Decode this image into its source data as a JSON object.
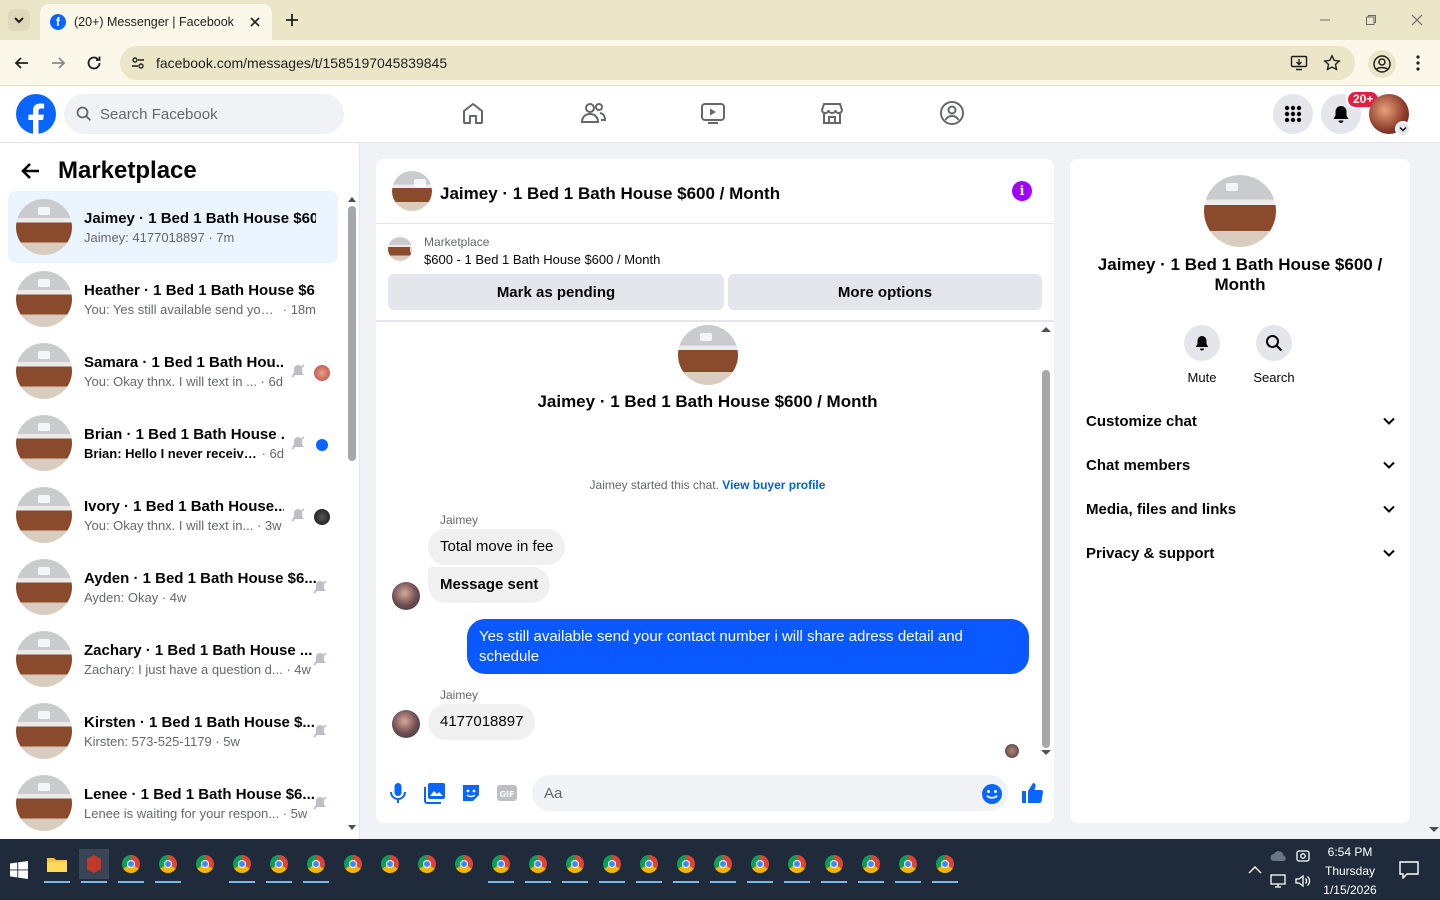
{
  "browser": {
    "tab_title": "(20+) Messenger | Facebook",
    "url": "facebook.com/messages/t/1585197045839845"
  },
  "fb": {
    "search_placeholder": "Search Facebook",
    "notification_badge": "20+",
    "accent": "#0866ff"
  },
  "sidebar": {
    "title": "Marketplace",
    "conversations": [
      {
        "name": "Jaimey · 1 Bed 1 Bath House $60...",
        "preview": "Jaimey: 4177018897",
        "time": "7m",
        "active": true
      },
      {
        "name": "Heather · 1 Bed 1 Bath House $6...",
        "preview": "You: Yes still available send your c...",
        "time": "18m"
      },
      {
        "name": "Samara · 1 Bed 1 Bath Hou...",
        "preview": "You: Okay thnx. I will text in ...",
        "time": "6d",
        "muted": true
      },
      {
        "name": "Brian · 1 Bed 1 Bath House ...",
        "preview": "Brian: Hello I never receive...",
        "time": "6d",
        "muted": true,
        "unread": true
      },
      {
        "name": "Ivory · 1 Bed 1 Bath House...",
        "preview": "You: Okay thnx. I will text in...",
        "time": "3w",
        "muted": true
      },
      {
        "name": "Ayden · 1 Bed 1 Bath House $6...",
        "preview": "Ayden: Okay",
        "time": "4w",
        "muted": true
      },
      {
        "name": "Zachary · 1 Bed 1 Bath House ...",
        "preview": "Zachary: I just have a question d...",
        "time": "4w",
        "muted": true
      },
      {
        "name": "Kirsten · 1 Bed 1 Bath House $...",
        "preview": "Kirsten: 573-525-1179",
        "time": "5w",
        "muted": true
      },
      {
        "name": "Lenee · 1 Bed 1 Bath House $6...",
        "preview": "Lenee is waiting for your respon...",
        "time": "5w",
        "muted": true
      }
    ]
  },
  "chat": {
    "title": "Jaimey · 1 Bed 1 Bath House $600 / Month",
    "listing_source": "Marketplace",
    "listing_title": "$600 - 1 Bed 1 Bath House $600 / Month",
    "mark_pending_label": "Mark as pending",
    "more_options_label": "More options",
    "intro_title": "Jaimey · 1 Bed 1 Bath House $600 / Month",
    "started_text": "Jaimey started this chat.",
    "buyer_profile_link": "View buyer profile",
    "messages": [
      {
        "sender": "Jaimey",
        "text": "Total move in fee",
        "direction": "in"
      },
      {
        "text": "Message sent",
        "direction": "in"
      },
      {
        "text": "Yes still available send your contact number i will share adress detail and schedule",
        "direction": "out"
      },
      {
        "sender": "Jaimey",
        "text": "4177018897",
        "direction": "in"
      }
    ],
    "input_placeholder": "Aa",
    "outgoing_color": "#0a58ff"
  },
  "details": {
    "title": "Jaimey · 1 Bed 1 Bath House $600 / Month",
    "mute_label": "Mute",
    "search_label": "Search",
    "sections": [
      "Customize chat",
      "Chat members",
      "Media, files and links",
      "Privacy & support"
    ]
  },
  "taskbar": {
    "time": "6:54 PM",
    "day": "Thursday",
    "date": "1/15/2026"
  }
}
